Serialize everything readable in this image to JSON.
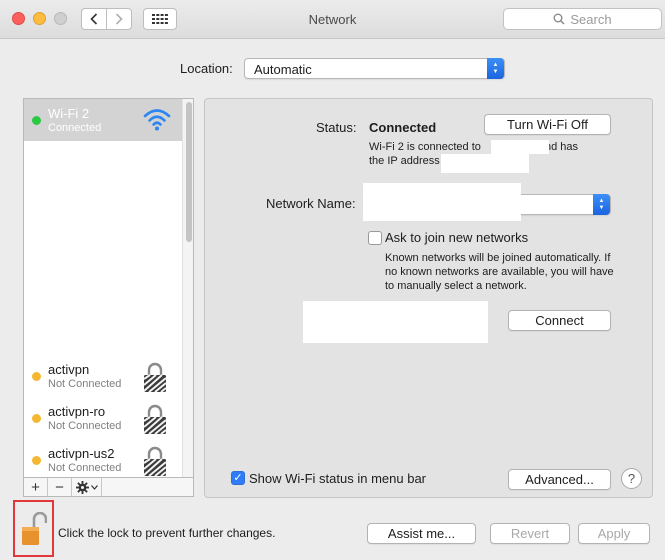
{
  "window": {
    "title": "Network",
    "search_placeholder": "Search",
    "icons": {
      "back": "chevron-left-icon",
      "forward": "chevron-right-icon",
      "grid": "grid-icon",
      "search": "search-icon"
    }
  },
  "location": {
    "label": "Location:",
    "value": "Automatic"
  },
  "services": [
    {
      "name": "Wi-Fi 2",
      "status": "Connected",
      "dot_color": "#2ac845",
      "icon": "wifi-icon",
      "selected": true
    },
    {
      "name": "activpn",
      "status": "Not Connected",
      "dot_color": "#f5b731",
      "icon": "lock-icon",
      "selected": false
    },
    {
      "name": "activpn-ro",
      "status": "Not Connected",
      "dot_color": "#f5b731",
      "icon": "lock-icon",
      "selected": false
    },
    {
      "name": "activpn-us2",
      "status": "Not Connected",
      "dot_color": "#f5b731",
      "icon": "lock-icon",
      "selected": false
    }
  ],
  "list_toolbar": {
    "add": "+",
    "remove": "−",
    "gear": "gear-icon"
  },
  "detail": {
    "status_label": "Status:",
    "status_value": "Connected",
    "turn_off_button": "Turn Wi-Fi Off",
    "status_desc_1a": "Wi-Fi 2 is connected to",
    "status_desc_1b": "and has",
    "status_desc_2": "the IP address",
    "network_name_label": "Network Name:",
    "ask_join_label": "Ask to join new networks",
    "ask_join_checked": false,
    "ask_join_desc_1": "Known networks will be joined automatically. If",
    "ask_join_desc_2": "no known networks are available, you will have",
    "ask_join_desc_3": "to manually select a network.",
    "connect_button": "Connect",
    "show_status_label": "Show Wi-Fi status in menu bar",
    "show_status_checked": true,
    "advanced_button": "Advanced...",
    "help_button": "?"
  },
  "footer": {
    "lock_text": "Click the lock to prevent further changes.",
    "assist_button": "Assist me...",
    "revert_button": "Revert",
    "apply_button": "Apply"
  },
  "colors": {
    "accent": "#2f7cf6",
    "lock_highlight": "#e2383c"
  }
}
